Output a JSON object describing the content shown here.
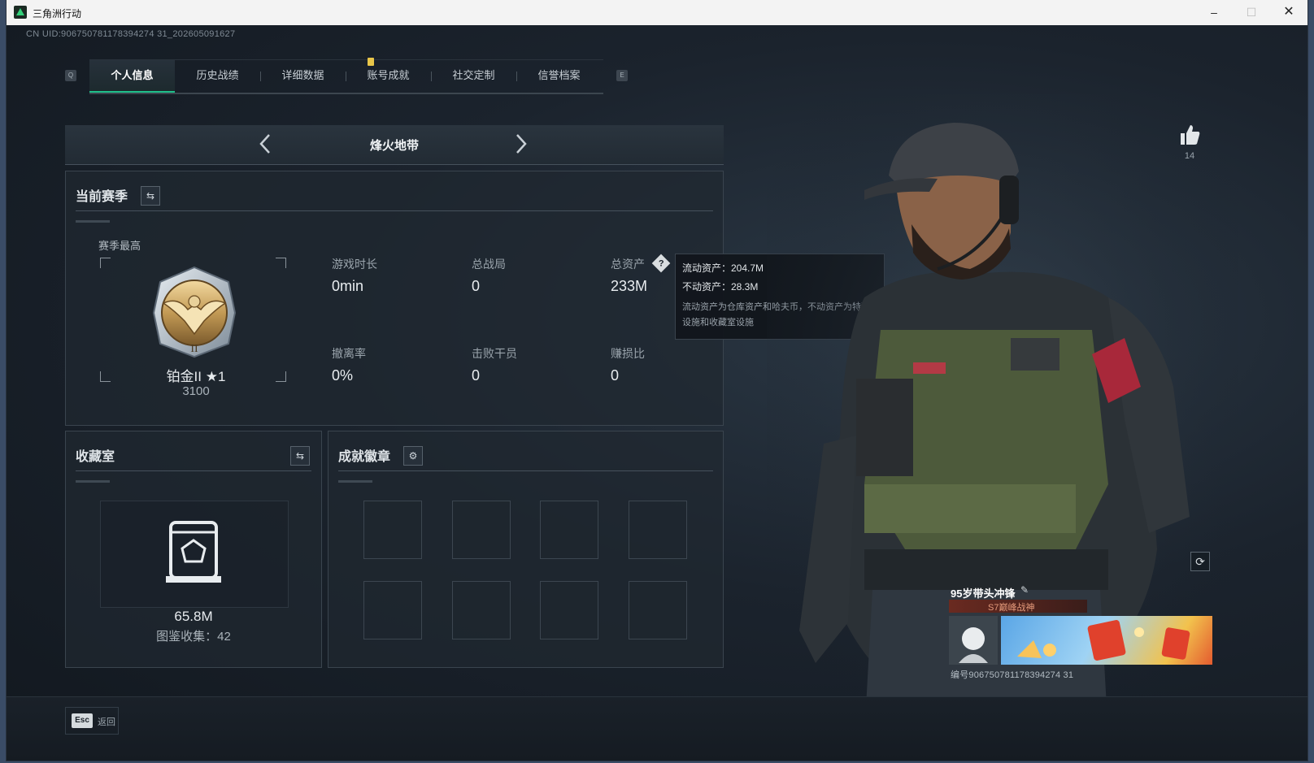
{
  "window": {
    "title": "三角洲行动",
    "minimize": "–",
    "maximize": "☐",
    "close": "✕"
  },
  "uid": "CN UID:906750781178394274 31_202605091627",
  "uid_display": "CN UID:906750781178394274 31_202605091627",
  "tabs": {
    "prev_key": "Q",
    "next_key": "E",
    "items": [
      {
        "label": "个人信息",
        "active": true
      },
      {
        "label": "历史战绩",
        "active": false
      },
      {
        "label": "详细数据",
        "active": false
      },
      {
        "label": "账号成就",
        "active": false
      },
      {
        "label": "社交定制",
        "active": false
      },
      {
        "label": "信誉档案",
        "active": false
      }
    ]
  },
  "mode": {
    "title": "烽火地带"
  },
  "season": {
    "title": "当前赛季",
    "subtitle": "赛季最高",
    "rank_name": "铂金II ★1",
    "rank_score": "3100",
    "stats": [
      {
        "label": "游戏时长",
        "value": "0min"
      },
      {
        "label": "总战局",
        "value": "0"
      },
      {
        "label": "总资产",
        "value": "233M"
      },
      {
        "label": "撤离率",
        "value": "0%"
      },
      {
        "label": "击败干员",
        "value": "0"
      },
      {
        "label": "赚损比",
        "value": "0"
      }
    ]
  },
  "tooltip": {
    "liquid": "流动资产：204.7M",
    "fixed": "不动资产：28.3M",
    "note": "流动资产为仓库资产和哈夫币，不动资产为特勤处设施和收藏室设施"
  },
  "collection": {
    "title": "收藏室",
    "value": "65.8M",
    "count": "图鉴收集：42"
  },
  "badges": {
    "title": "成就徽章",
    "slots": 8
  },
  "likes": {
    "count": "14"
  },
  "player": {
    "name": "95岁带头冲锋",
    "title": "S7巅峰战神",
    "id": "编号906750781178394274 31"
  },
  "footer": {
    "esc_key": "Esc",
    "esc_label": "返回"
  },
  "colors": {
    "accent": "#1fbf8a",
    "notification": "#e8c549"
  }
}
